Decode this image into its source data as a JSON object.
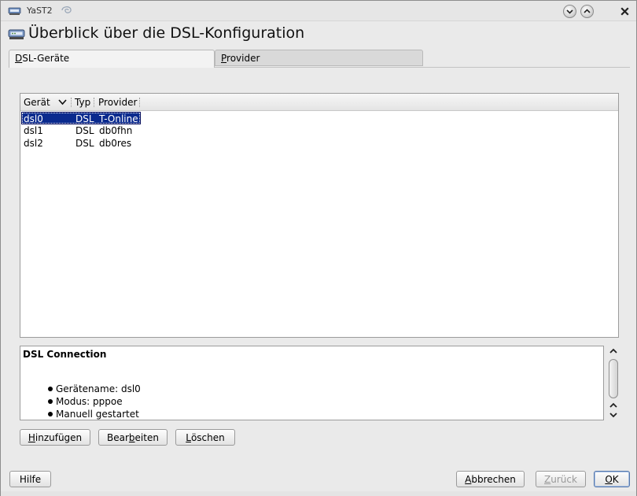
{
  "window": {
    "title": "YaST2",
    "controls": [
      "minimize",
      "maximize",
      "close"
    ]
  },
  "header": {
    "title": "Überblick über die DSL-Konfiguration",
    "icon": "dsl-modem-icon"
  },
  "tabs": [
    {
      "label_mnemonic": "D",
      "label_rest": "SL-Geräte",
      "active": true
    },
    {
      "label_mnemonic": "P",
      "label_rest": "rovider",
      "active": false
    }
  ],
  "table": {
    "columns": [
      "Gerät",
      "Typ",
      "Provider"
    ],
    "rows": [
      {
        "device": "dsl0",
        "type": "DSL",
        "provider": "T-Online",
        "selected": true
      },
      {
        "device": "dsl1",
        "type": "DSL",
        "provider": "db0fhn",
        "selected": false
      },
      {
        "device": "dsl2",
        "type": "DSL",
        "provider": "db0res",
        "selected": false
      }
    ]
  },
  "details": {
    "title": "DSL Connection",
    "items": [
      "Gerätename: dsl0",
      "Modus: pppoe",
      "Manuell gestartet"
    ]
  },
  "actions": {
    "add": {
      "mnemonic": "H",
      "rest": "inzufügen"
    },
    "edit": {
      "before": "Bear",
      "mnemonic": "b",
      "rest": "eiten"
    },
    "delete": {
      "mnemonic": "L",
      "rest": "öschen"
    }
  },
  "footer": {
    "help": "Hilfe",
    "cancel": {
      "mnemonic": "A",
      "rest": "bbrechen"
    },
    "back": {
      "mnemonic": "Z",
      "rest": "urück",
      "enabled": false
    },
    "ok": {
      "mnemonic": "O",
      "rest": "K"
    }
  },
  "colors": {
    "selection": "#0a2a8e",
    "window_bg": "#eaeaea"
  }
}
